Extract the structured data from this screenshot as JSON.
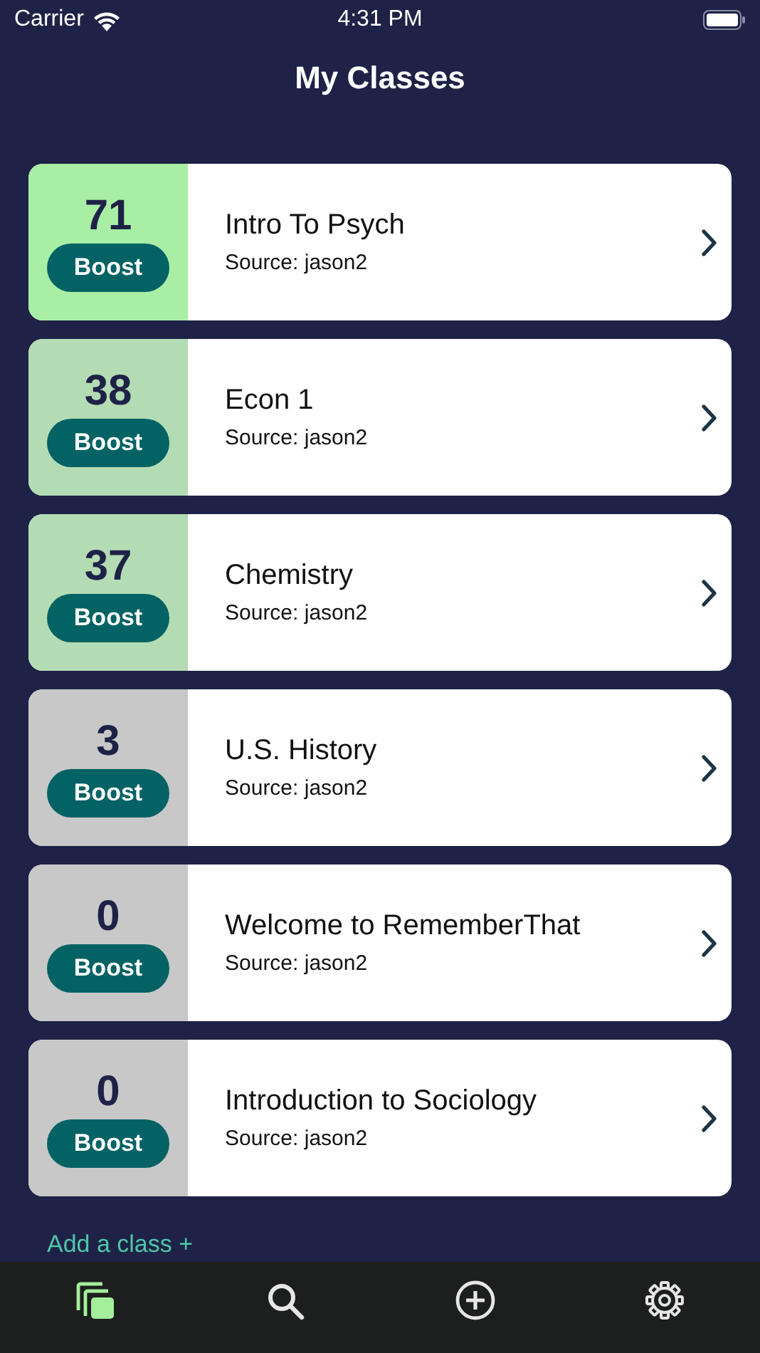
{
  "status_bar": {
    "carrier": "Carrier",
    "time": "4:31 PM"
  },
  "title": "My Classes",
  "classes": [
    {
      "score": "71",
      "boost": "Boost",
      "name": "Intro To Psych",
      "source": "Source: jason2",
      "color": "#a8eea5"
    },
    {
      "score": "38",
      "boost": "Boost",
      "name": "Econ 1",
      "source": "Source: jason2",
      "color": "#b4dcb4"
    },
    {
      "score": "37",
      "boost": "Boost",
      "name": "Chemistry",
      "source": "Source: jason2",
      "color": "#b4dcb4"
    },
    {
      "score": "3",
      "boost": "Boost",
      "name": "U.S. History",
      "source": "Source: jason2",
      "color": "#c8c8c8"
    },
    {
      "score": "0",
      "boost": "Boost",
      "name": "Welcome to RememberThat",
      "source": "Source: jason2",
      "color": "#c8c8c8"
    },
    {
      "score": "0",
      "boost": "Boost",
      "name": "Introduction to Sociology",
      "source": "Source: jason2",
      "color": "#c8c8c8"
    }
  ],
  "add_class": "Add a class +",
  "tab_bar": [
    {
      "kind": "classes",
      "selected": true
    },
    {
      "kind": "search",
      "selected": false
    },
    {
      "kind": "add",
      "selected": false
    },
    {
      "kind": "settings",
      "selected": false
    }
  ]
}
